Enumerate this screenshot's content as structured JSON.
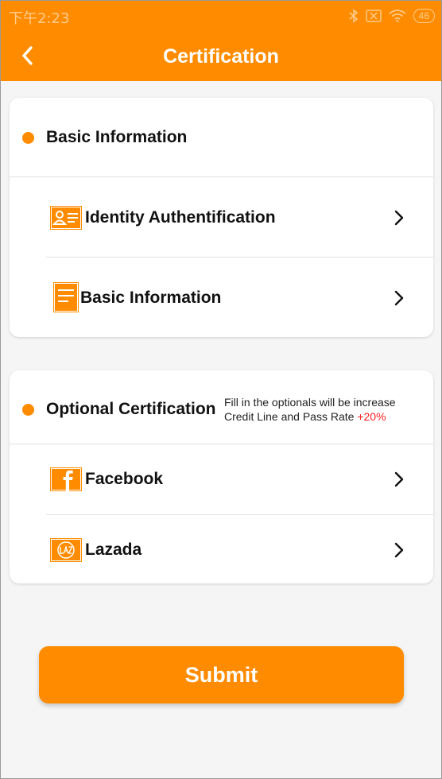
{
  "status_bar": {
    "time": "下午2:23",
    "battery": "46"
  },
  "header": {
    "title": "Certification",
    "back_icon": "chevron-left-icon"
  },
  "basic_section": {
    "title": "Basic Information",
    "items": [
      {
        "label": "Identity Authentification",
        "icon": "id-card-icon"
      },
      {
        "label": "Basic Information",
        "icon": "document-icon"
      }
    ]
  },
  "optional_section": {
    "title": "Optional Certification",
    "note_line1": "Fill in the optionals will be increase",
    "note_line2": "Credit Line and Pass Rate",
    "note_highlight": "+20%",
    "items": [
      {
        "label": "Facebook",
        "icon": "facebook-icon"
      },
      {
        "label": "Lazada",
        "icon": "lazada-icon"
      }
    ]
  },
  "submit_label": "Submit",
  "colors": {
    "accent": "#ff8c00",
    "highlight": "#ff2020",
    "background": "#f5f5f5"
  }
}
